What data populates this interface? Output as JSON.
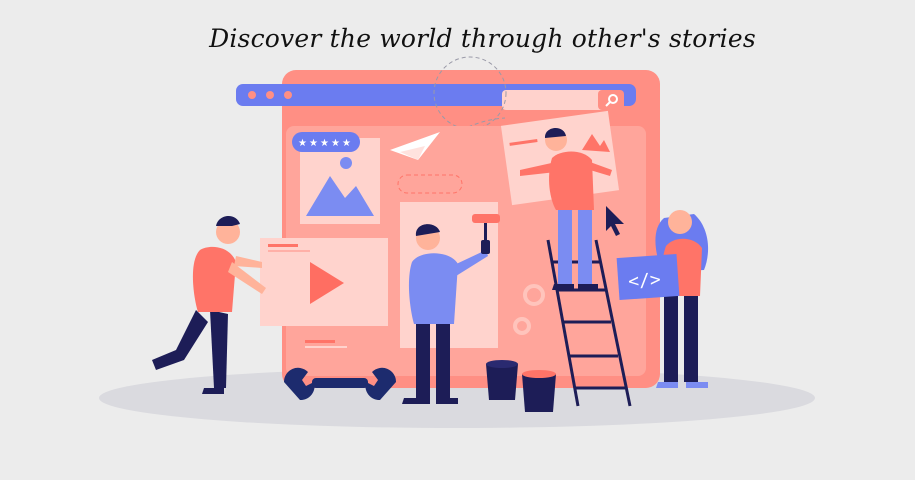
{
  "headline": "Discover the world through other's stories",
  "icons": {
    "search": "search-icon",
    "play": "play-icon",
    "code": "code-icon",
    "cursor": "cursor-icon",
    "rating": "five-star-rating",
    "picture": "image-placeholder-icon",
    "paper_plane": "paper-plane-icon",
    "gear": "gear-icon",
    "wrench": "wrench-icon"
  },
  "code_tag": "</>",
  "colors": {
    "background": "#ececec",
    "browser": "#ff8c80",
    "browser_inner": "#ffb3aa",
    "toolbar": "#6b7cf0",
    "navy": "#1d1d57",
    "shirt": "#ff7468",
    "blue_shirt": "#7b8cf2"
  }
}
